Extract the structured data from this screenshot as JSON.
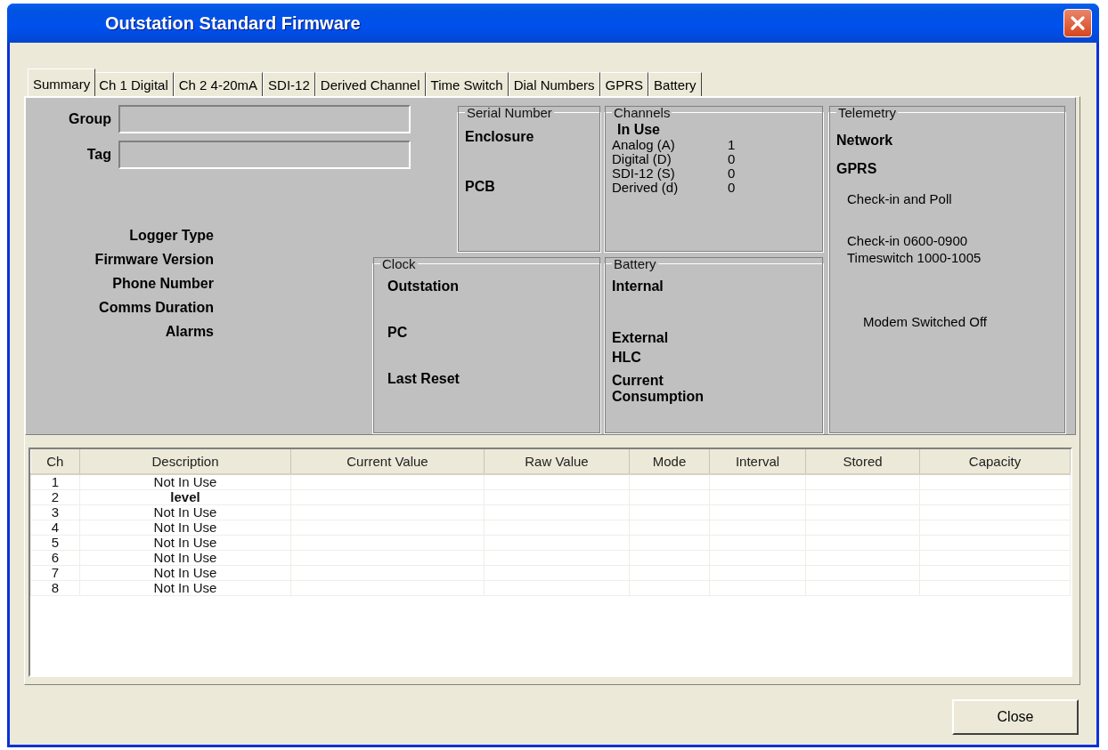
{
  "window": {
    "title": "Outstation Standard Firmware"
  },
  "tabs": [
    {
      "label": "Summary",
      "selected": true
    },
    {
      "label": "Ch 1 Digital",
      "selected": false
    },
    {
      "label": "Ch 2 4-20mA",
      "selected": false
    },
    {
      "label": "SDI-12",
      "selected": false
    },
    {
      "label": "Derived Channel",
      "selected": false
    },
    {
      "label": "Time Switch",
      "selected": false
    },
    {
      "label": "Dial Numbers",
      "selected": false
    },
    {
      "label": "GPRS",
      "selected": false
    },
    {
      "label": "Battery",
      "selected": false
    }
  ],
  "summary": {
    "fields": [
      {
        "label": "Group"
      },
      {
        "label": "Tag"
      }
    ],
    "info_labels": [
      "Logger Type",
      "Firmware Version",
      "Phone Number",
      "Comms Duration",
      "Alarms"
    ],
    "serial_number": {
      "title": "Serial Number",
      "items": [
        "Enclosure",
        "PCB"
      ]
    },
    "channels": {
      "title": "Channels",
      "heading": "In Use",
      "rows": [
        {
          "label": "Analog (A)",
          "value": "1"
        },
        {
          "label": "Digital (D)",
          "value": "0"
        },
        {
          "label": "SDI-12 (S)",
          "value": "0"
        },
        {
          "label": "Derived (d)",
          "value": "0"
        }
      ]
    },
    "clock": {
      "title": "Clock",
      "items": [
        "Outstation",
        "PC",
        "Last Reset"
      ]
    },
    "battery": {
      "title": "Battery",
      "items": [
        "Internal",
        "External",
        "HLC",
        "Current Consumption"
      ]
    },
    "telemetry": {
      "title": "Telemetry",
      "network": "Network",
      "type": "GPRS",
      "mode": "Check-in and Poll",
      "schedule": [
        "Check-in 0600-0900",
        "Timeswitch 1000-1005"
      ],
      "status": "Modem Switched Off"
    }
  },
  "table": {
    "columns": [
      "Ch",
      "Description",
      "Current Value",
      "Raw Value",
      "Mode",
      "Interval",
      "Stored",
      "Capacity"
    ],
    "rows": [
      {
        "ch": "1",
        "description": "Not In Use",
        "in_use": false
      },
      {
        "ch": "2",
        "description": "level",
        "in_use": true
      },
      {
        "ch": "3",
        "description": "Not In Use",
        "in_use": false
      },
      {
        "ch": "4",
        "description": "Not In Use",
        "in_use": false
      },
      {
        "ch": "5",
        "description": "Not In Use",
        "in_use": false
      },
      {
        "ch": "6",
        "description": "Not In Use",
        "in_use": false
      },
      {
        "ch": "7",
        "description": "Not In Use",
        "in_use": false
      },
      {
        "ch": "8",
        "description": "Not In Use",
        "in_use": false
      }
    ]
  },
  "buttons": [
    {
      "label": "Close"
    }
  ]
}
